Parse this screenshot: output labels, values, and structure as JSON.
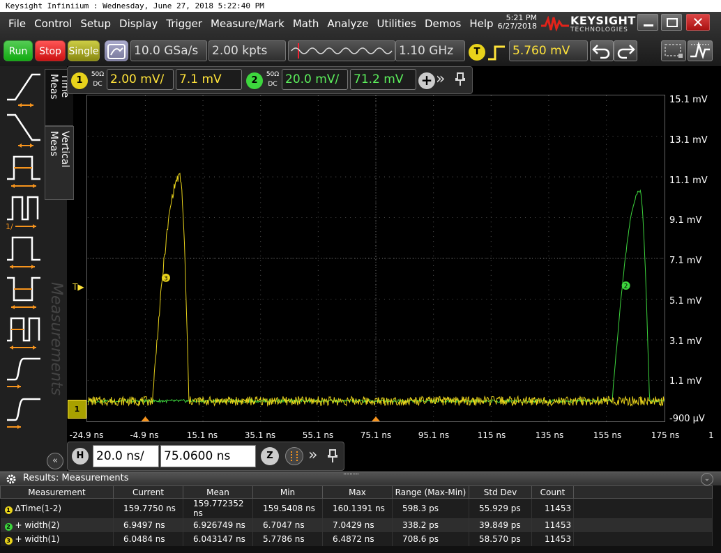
{
  "window": {
    "title": "Keysight Infiniium : Wednesday, June 27, 2018 5:22:40 PM",
    "time": "5:21 PM",
    "date": "6/27/2018",
    "close_label": "✕"
  },
  "logo": {
    "name": "KEYSIGHT",
    "sub": "TECHNOLOGIES"
  },
  "menu": [
    "File",
    "Control",
    "Setup",
    "Display",
    "Trigger",
    "Measure/Mark",
    "Math",
    "Analyze",
    "Utilities",
    "Demos",
    "Help"
  ],
  "toolbar": {
    "run_label": "Run",
    "stop_label": "Stop",
    "single_label": "Single",
    "sample_rate": "10.0 GSa/s",
    "memory_depth": "2.00 kpts",
    "bandwidth": "1.10 GHz",
    "trigger_badge": "T",
    "trigger_level": "5.760 mV"
  },
  "channels": {
    "ch1": {
      "badge": "1",
      "impedance": "50Ω",
      "coupling": "DC",
      "scale": "2.00 mV/",
      "offset": "7.1 mV",
      "color": "#e8d21b"
    },
    "ch2": {
      "badge": "2",
      "impedance": "50Ω",
      "coupling": "DC",
      "scale": "20.0 mV/",
      "offset": "71.2 mV",
      "color": "#3dd63d"
    },
    "add_label": "+",
    "more_label": "»"
  },
  "sidebar": {
    "tabs": [
      "Time Meas",
      "Vertical Meas"
    ],
    "watermark": "Measurements",
    "collapse_label": "«",
    "icons": [
      "rise-time-icon",
      "fall-time-icon",
      "positive-width-icon",
      "period-icon",
      "frequency-icon",
      "negative-width-icon",
      "duty-cycle-icon",
      "delta-time-rise-icon",
      "delta-time-edge-icon"
    ],
    "icon_label_period": "1/"
  },
  "plot": {
    "y_labels": [
      "15.1 mV",
      "13.1 mV",
      "11.1 mV",
      "9.1 mV",
      "7.1 mV",
      "5.1 mV",
      "3.1 mV",
      "1.1 mV",
      "-900 µV"
    ],
    "x_labels": [
      "-24.9 ns",
      "-4.9 ns",
      "15.1 ns",
      "35.1 ns",
      "55.1 ns",
      "75.1 ns",
      "95.1 ns",
      "115 ns",
      "135 ns",
      "155 ns",
      "175 ns"
    ],
    "x_edge_label": "1",
    "trigger_marker": "T",
    "ground_marker": "1",
    "ymin": -0.9,
    "ymax": 15.1,
    "xmin": -24.9,
    "xmax": 175,
    "waveform_ch1": {
      "color": "#e8d21b",
      "baseline": 0.1,
      "peak_time": 7.0,
      "peak_value": 11.1,
      "rise_start": -2.5,
      "fall_end": 10.2,
      "marker": "3"
    },
    "waveform_ch2": {
      "color": "#3dd63d",
      "baseline": 0.1,
      "peak_time": 166.6,
      "peak_value": 10.4,
      "rise_start": 157.0,
      "fall_end": 170.0,
      "marker": "2"
    }
  },
  "timebase": {
    "badge": "H",
    "scale": "20.0 ns/",
    "position": "75.0600 ns",
    "zoom_label": "Z",
    "more_label": "»"
  },
  "results": {
    "title": "Results: Measurements",
    "grip": "\"\"\"\"\"",
    "collapse_label": "⌄",
    "headers": [
      "Measurement",
      "Current",
      "Mean",
      "Min",
      "Max",
      "Range (Max-Min)",
      "Std Dev",
      "Count"
    ],
    "rows": [
      {
        "badge": "1",
        "badge_color": "#e8d21b",
        "name": "ΔTime(1-2)",
        "current": "159.7750 ns",
        "mean": "159.772352 ns",
        "min": "159.5408 ns",
        "max": "160.1391 ns",
        "range": "598.3 ps",
        "std": "55.929 ps",
        "count": "11453"
      },
      {
        "badge": "2",
        "badge_color": "#3dd63d",
        "name": "+ width(2)",
        "current": "6.9497 ns",
        "mean": "6.926749 ns",
        "min": "6.7047 ns",
        "max": "7.0429 ns",
        "range": "338.2 ps",
        "std": "39.849 ps",
        "count": "11453"
      },
      {
        "badge": "3",
        "badge_color": "#e8d21b",
        "name": "+ width(1)",
        "current": "6.0484 ns",
        "mean": "6.043147 ns",
        "min": "5.7786 ns",
        "max": "6.4872 ns",
        "range": "708.6 ps",
        "std": "58.570 ps",
        "count": "11453"
      }
    ]
  }
}
